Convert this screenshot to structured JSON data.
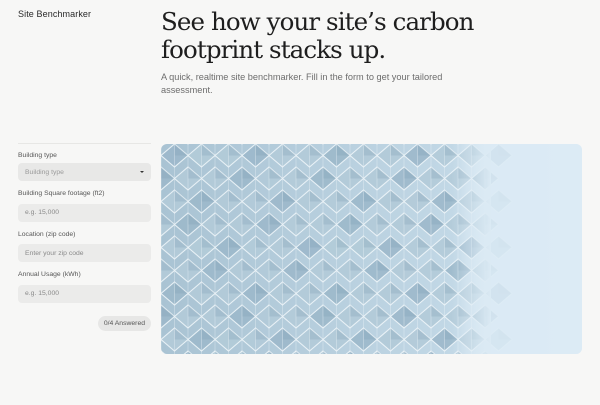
{
  "header": {
    "brand": "Site Benchmarker",
    "headline": "See how your site’s carbon footprint stacks up.",
    "subtitle": "A quick, realtime site benchmarker. Fill in the form to get your tailored assessment."
  },
  "form": {
    "building_type": {
      "label": "Building type",
      "placeholder": "Building type"
    },
    "square_footage": {
      "label": "Building Square footage (ft2)",
      "placeholder": "e.g. 15,000"
    },
    "location": {
      "label": "Location (zip code)",
      "placeholder": "Enter your zip code"
    },
    "annual_usage": {
      "label": "Annual Usage (kWh)",
      "placeholder": "e.g. 15,000"
    },
    "progress": {
      "text": "0/4 Answered",
      "answered": 0,
      "total": 4
    }
  },
  "hero_image": {
    "subject": "glass building facade",
    "colors": {
      "sky": "#dbeaf4",
      "glass": "#a9c3d3",
      "frame": "#eef5f9",
      "shadow": "#7e9fb4"
    }
  }
}
